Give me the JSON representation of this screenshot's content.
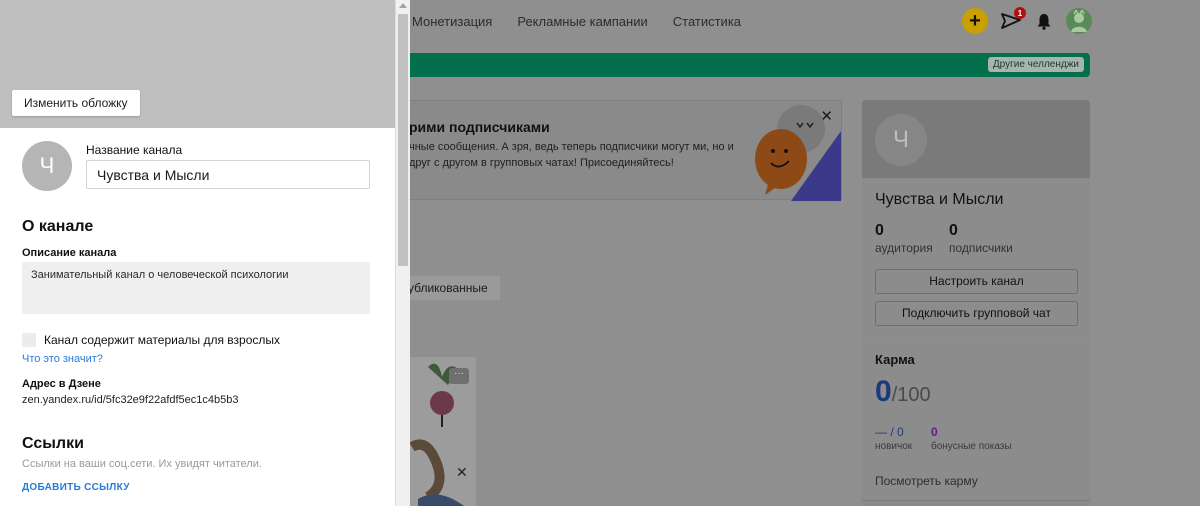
{
  "background": {
    "nav": [
      "Монетизация",
      "Рекламные кампании",
      "Статистика"
    ],
    "msg_badge": "1",
    "challenge_label": "Другие челленджи",
    "promo": {
      "title": "рими подписчиками",
      "text": "чные сообщения. А зря, ведь теперь подписчики могут ми, но и друг с другом в групповых чатах! Присоединяйтесь!"
    },
    "published_tab": "убликованные",
    "channel": {
      "avatar_letter": "Ч",
      "name": "Чувства и Мысли",
      "audience_num": "0",
      "audience_label": "аудитория",
      "subscribers_num": "0",
      "subscribers_label": "подписчики",
      "setup_button": "Настроить канал",
      "group_chat_button": "Подключить групповой чат"
    },
    "karma": {
      "title": "Карма",
      "value": "0",
      "max": "/100",
      "newbie_val": "— / 0",
      "newbie_label": "новичок",
      "bonus_val": "0",
      "bonus_label": "бонусные показы",
      "view_link": "Посмотреть карму"
    }
  },
  "drawer": {
    "change_cover": "Изменить обложку",
    "avatar_letter": "Ч",
    "name_label": "Название канала",
    "name_value": "Чувства и Мысли",
    "about_title": "О канале",
    "desc_label": "Описание канала",
    "desc_value": "Занимательный канал о человеческой психологии",
    "adult_label": "Канал содержит материалы для взрослых",
    "what_link": "Что это значит?",
    "address_label": "Адрес в Дзене",
    "address_value": "zen.yandex.ru/id/5fc32e9f22afdf5ec1c4b5b3",
    "links_title": "Ссылки",
    "links_hint": "Ссылки на ваши соц.сети. Их увидят читатели.",
    "add_link": "ДОБАВИТЬ ССЫЛКУ"
  }
}
